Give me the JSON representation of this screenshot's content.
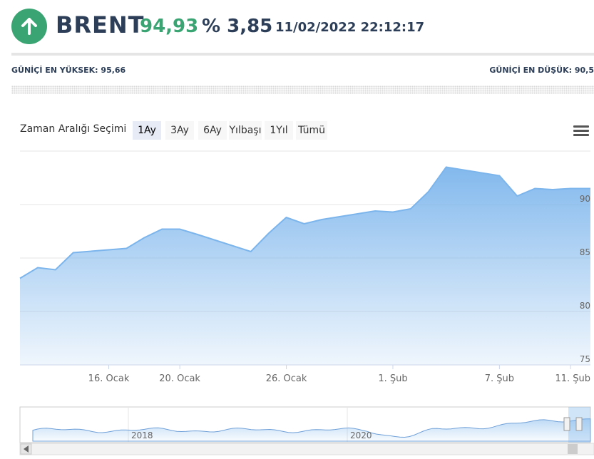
{
  "header": {
    "symbol": "BRENT",
    "price": "94,93",
    "change": "% 3,85",
    "datetime": "11/02/2022 22:12:17",
    "trend_icon": "arrow-up-icon",
    "up_color": "#3aa573"
  },
  "day_range": {
    "high_label": "GÜNİÇİ EN YÜKSEK: 95,66",
    "low_label": "GÜNİÇİ EN DÜŞÜK: 90,5"
  },
  "range_selector": {
    "label": "Zaman Aralığı Seçimi",
    "buttons": [
      "1Ay",
      "3Ay",
      "6Ay",
      "Yılbaşı",
      "1Yıl",
      "Tümü"
    ],
    "selected": "1Ay"
  },
  "chart_data": {
    "type": "area",
    "series": [
      {
        "x": [
          "2022-01-11",
          "2022-01-12",
          "2022-01-13",
          "2022-01-14",
          "2022-01-17",
          "2022-01-18",
          "2022-01-19",
          "2022-01-20",
          "2022-01-21",
          "2022-01-24",
          "2022-01-25",
          "2022-01-26",
          "2022-01-27",
          "2022-01-28",
          "2022-01-31",
          "2022-02-01",
          "2022-02-02",
          "2022-02-03",
          "2022-02-04",
          "2022-02-07",
          "2022-02-08",
          "2022-02-09",
          "2022-02-10",
          "2022-02-11"
        ],
        "values": [
          83.1,
          84.1,
          83.9,
          85.5,
          85.9,
          86.9,
          87.7,
          87.7,
          87.2,
          85.6,
          87.3,
          88.8,
          88.2,
          88.6,
          89.4,
          89.3,
          89.6,
          91.2,
          93.5,
          92.7,
          90.8,
          91.5,
          91.4,
          91.5
        ]
      }
    ],
    "x_ticks": [
      "16. Ocak",
      "20. Ocak",
      "26. Ocak",
      "1. Şub",
      "7. Şub",
      "11. Şub"
    ],
    "y_ticks": [
      75,
      80,
      85,
      90
    ],
    "ylim": [
      75,
      95
    ],
    "grid": true,
    "colors": {
      "line": "#7cb5ec",
      "fill_top": "#7cb5ec",
      "fill_bottom": "#e8f1fb"
    },
    "navigator": {
      "x_labels": [
        "2018",
        "2020"
      ]
    }
  }
}
